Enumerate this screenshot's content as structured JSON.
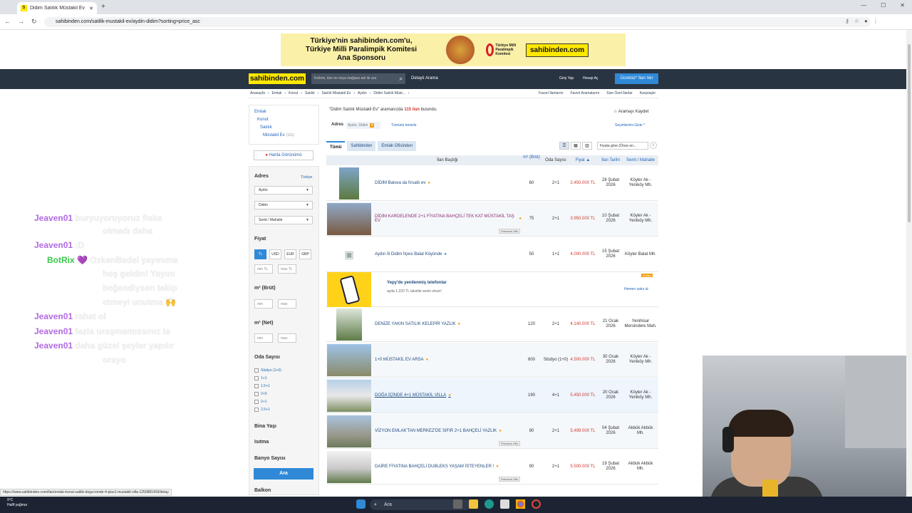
{
  "browser": {
    "tab_title": "Didim Satılık Müstakil Ev Fiyatla",
    "url": "sahibinden.com/satilik-mustakil-ev/aydin-didim?sorting=price_asc"
  },
  "banner": {
    "text1": "Türkiye'nin sahibinden.com'u,",
    "text2": "Türkiye Milli Paralimpik Komitesi",
    "text3": "Ana Sponsoru",
    "partner": "Türkiye Milli Paralimpik Komitesi",
    "brand": "sahibinden.com"
  },
  "header": {
    "logo": "sahibinden.com",
    "search_placeholder": "Kelime, ilan no veya mağaza adı ile ara",
    "detailed": "Detaylı Arama",
    "login": "Giriş Yap",
    "signup": "Hesap Aç",
    "post_ad": "Ücretsiz* İlan Ver"
  },
  "breadcrumb": [
    "Anasayfa",
    "Emlak",
    "Konut",
    "Satılık",
    "Satılık Müstakil Ev",
    "Aydın",
    "Didim Satılık Müst..."
  ],
  "top_links": [
    "Favori İlanlarım",
    "Favori Aramalarım",
    "Size Özel İlanlar",
    "Karşılaştır"
  ],
  "categories": {
    "c1": "Emlak",
    "c2": "Konut",
    "c3": "Satılık",
    "c4": "Müstakil Ev",
    "c4_count": "(115)"
  },
  "map_view": "Harita Görünümü",
  "filters": {
    "adres": "Adres",
    "turkiye": "Türkiye",
    "il": "Aydın",
    "ilce": "Didim",
    "mahalle": "Semt / Mahalle",
    "fiyat": "Fiyat",
    "currencies": [
      "TL",
      "USD",
      "EUR",
      "GBP"
    ],
    "min_tl": "min TL",
    "max_tl": "max TL",
    "m2_brut": "m² (Brüt)",
    "m2_net": "m² (Net)",
    "min": "min",
    "max": "max",
    "oda": "Oda Sayısı",
    "oda_options": [
      "Stüdyo (1+0)",
      "1+1",
      "1.5+1",
      "2+0",
      "2+1",
      "2.5+1"
    ],
    "bina_yasi": "Bina Yaşı",
    "isitma": "Isıtma",
    "banyo": "Banyo Sayısı",
    "balkon": "Balkon",
    "ara": "Ara"
  },
  "chat": [
    {
      "user": "Jeaven01",
      "msg": "buryuyoruyoruz fiske",
      "color": "#b06ae0"
    },
    {
      "user": "",
      "msg": "olmadı daha",
      "color": "#b06ae0"
    },
    {
      "user": "Jeaven01",
      "msg": ":D",
      "color": "#b06ae0"
    },
    {
      "user": "BotRix",
      "msg": "💜 OzkanBedel yayınıma",
      "color": "#39c84c"
    },
    {
      "user": "",
      "msg": "hoş geldin! Yayını",
      "color": ""
    },
    {
      "user": "",
      "msg": "beğendiysen takip",
      "color": ""
    },
    {
      "user": "",
      "msg": "etmeyi unutma 🙌",
      "color": ""
    },
    {
      "user": "Jeaven01",
      "msg": "rahat ol",
      "color": "#b06ae0"
    },
    {
      "user": "Jeaven01",
      "msg": "fazla uraşmamıssınız la",
      "color": "#b06ae0"
    },
    {
      "user": "Jeaven01",
      "msg": "daha güzel şeyler yapılır",
      "color": "#b06ae0"
    },
    {
      "user": "",
      "msg": "orayo",
      "color": ""
    }
  ],
  "results": {
    "query": "\"Didim Satılık Müstakil Ev\"",
    "mid": " aramanızda ",
    "count": "115 ilan",
    "suffix": " bulundu.",
    "save_search": "☆ Aramayı Kaydet",
    "address_label": "Adres",
    "address_value": "Aydın, Didim",
    "clear": "Tümünü temizle",
    "hide": "Seçimlerimi Gizle ^",
    "tabs": [
      "Tümü",
      "Sahibinden",
      "Emlak Ofisinden"
    ],
    "sort": "Fiyata göre (Önce en...",
    "columns": {
      "title": "İlan Başlığı",
      "m2": "m² (Brüt)",
      "rooms": "Oda Sayısı",
      "price": "Fiyat ▲",
      "date": "İlan Tarihi",
      "district": "Semt / Mahalle"
    },
    "listings": [
      {
        "title": "DİDİM Balova da fırsatlı ev",
        "m2": "60",
        "rooms": "2+1",
        "price": "2.450.000 TL",
        "date": "28 Şubat 2026",
        "loc": "Köyler Ak - Yeniköy Mh.",
        "premium": ""
      },
      {
        "title": "DİDİM KARDELENDE 2+1 FİYATINA BAHÇELİ TEK KAT MÜSTAKİL TAŞ EV",
        "m2": "75",
        "rooms": "2+1",
        "price": "3.950.000 TL",
        "date": "10 Şubat 2026",
        "loc": "Köyler Ak - Yeniköy Mh.",
        "premium": "Premium Ofis"
      },
      {
        "title": "Aydın İli Didim İlçesi Balat Köyünde",
        "m2": "50",
        "rooms": "1+1",
        "price": "4.000.000 TL",
        "date": "15 Şubat 2026",
        "loc": "Köyler Balat Mh.",
        "premium": ""
      },
      {
        "title": "DENİZE YAKIN SATILIK KELEPİR YAZLIK",
        "m2": "120",
        "rooms": "2+1",
        "price": "4.140.000 TL",
        "date": "21 Ocak 2026",
        "loc": "Yenihisar Mersindere Mah.",
        "premium": ""
      },
      {
        "title": "1+0 MÜSTAKİL EV ARSA",
        "m2": "600",
        "rooms": "Stüdyo (1+0)",
        "price": "4.500.000 TL",
        "date": "30 Ocak 2026",
        "loc": "Köyler Ak - Yeniköy Mh.",
        "premium": ""
      },
      {
        "title": "DOĞA İÇİNDE 4+1 MÜSTAKİL VİLLA",
        "m2": "190",
        "rooms": "4+1",
        "price": "5.450.000 TL",
        "date": "20 Ocak 2026",
        "loc": "Köyler Ak - Yeniköy Mh.",
        "premium": ""
      },
      {
        "title": "VİZYON EMLAK'TAN MERKEZ'DE SIFIR 2+1 BAHÇELİ YAZLIK",
        "m2": "90",
        "rooms": "2+1",
        "price": "5.499.000 TL",
        "date": "04 Şubat 2026",
        "loc": "Akbük Akbük Mh.",
        "premium": "Premium Ofis"
      },
      {
        "title": "DAİRE FİYATINA BAHÇELİ DUBLEKS YAŞAM İSTEYENLER !",
        "m2": "90",
        "rooms": "2+1",
        "price": "5.500.000 TL",
        "date": "19 Şubat 2026",
        "loc": "Akbük Akbük Mh.",
        "premium": "Premium Ofis"
      }
    ],
    "ad": {
      "title": "Yepy'de yenilenmiş telefonlar",
      "sub": "ayda 1.220 TL taksitle senin olsun!",
      "cta": "Hemen satın al",
      "badge": "Doliam"
    }
  },
  "status_url": "https://www.sahibinden.com/ilan/emlak-konut-satilik-doga-icinde-4-plus1-mustakil-villa-1250881493/detay",
  "taskbar": {
    "temp": "9°C",
    "weather": "Hafif yağmur",
    "search": "Ara"
  }
}
